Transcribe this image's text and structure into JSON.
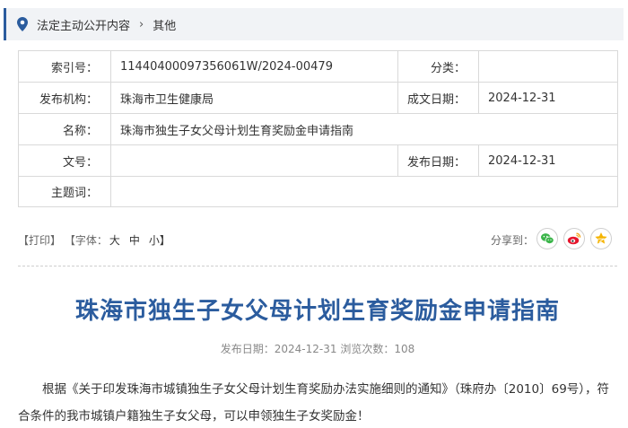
{
  "breadcrumb": {
    "items": [
      "法定主动公开内容",
      "其他"
    ],
    "separator": "›"
  },
  "meta": {
    "index_label": "索引号：",
    "index_value": "11440400097356061W/2024-00479",
    "category_label": "分类：",
    "category_value": "",
    "publisher_label": "发布机构：",
    "publisher_value": "珠海市卫生健康局",
    "created_label": "成文日期：",
    "created_value": "2024-12-31",
    "name_label": "名称：",
    "name_value": "珠海市独生子女父母计划生育奖励金申请指南",
    "docno_label": "文号：",
    "docno_value": "",
    "pubdate_label": "发布日期：",
    "pubdate_value": "2024-12-31",
    "subject_label": "主题词：",
    "subject_value": ""
  },
  "tools": {
    "print": "【打印】",
    "font_label": "【字体：",
    "font_large": "大",
    "font_medium": "中",
    "font_small": "小】",
    "share_label": "分享到："
  },
  "article": {
    "title": "珠海市独生子女父母计划生育奖励金申请指南",
    "pub_info": "发布日期：2024-12-31  浏览次数：108",
    "para1": "根据《关于印发珠海市城镇独生子女父母计划生育奖励办法实施细则的通知》（珠府办〔2010〕69号），符合条件的我市城镇户籍独生子女父母，可以申领独生子女奖励金！"
  },
  "colors": {
    "accent": "#2b5c9e",
    "wechat": "#3bb54a",
    "weibo": "#e6162d"
  }
}
